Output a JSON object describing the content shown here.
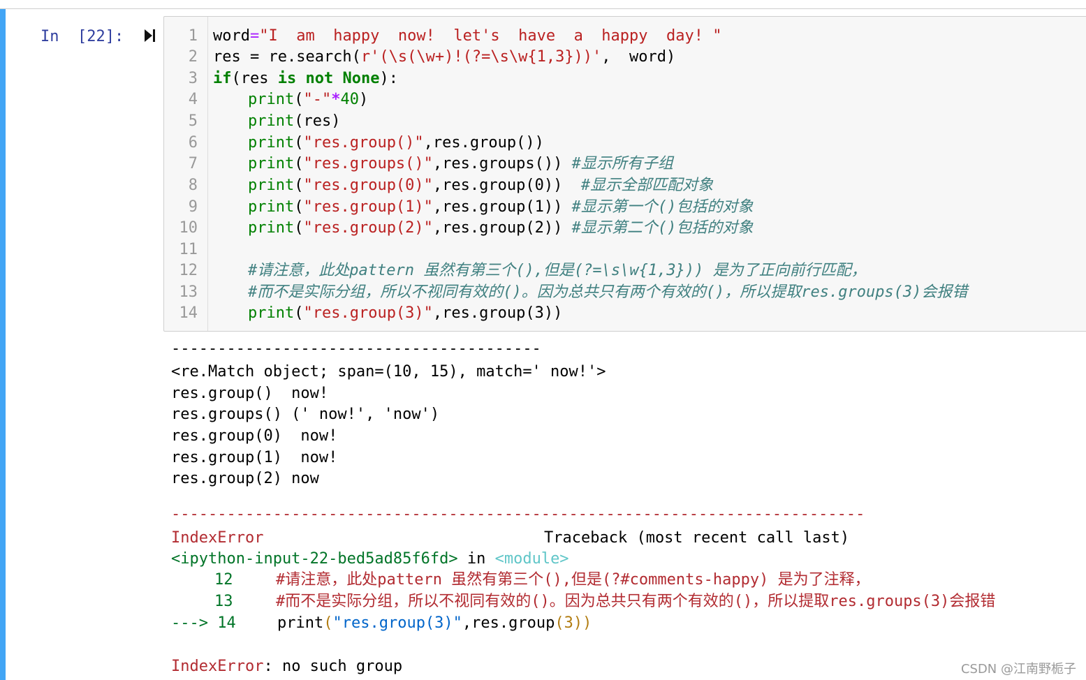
{
  "cell": {
    "prompt": "In  [22]:",
    "run_icon": "run-cell-icon",
    "line_numbers": [
      "1",
      "2",
      "3",
      "4",
      "5",
      "6",
      "7",
      "8",
      "9",
      "10",
      "11",
      "12",
      "13",
      "14"
    ]
  },
  "code": {
    "l1_word": "word",
    "l1_eq": "=",
    "l1_str": "\"I  am  happy  now!  let's  have  a  happy  day! \"",
    "l2_a": "res = re.search(",
    "l2_str": "r'(\\s(\\w+)!(?=\\s\\w{1,3}))'",
    "l2_b": ",  word)",
    "l3_if": "if",
    "l3_a": "(res ",
    "l3_is": "is",
    "l3_sp": " ",
    "l3_not": "not",
    "l3_sp2": " ",
    "l3_none": "None",
    "l3_b": "):",
    "print": "print",
    "l4_open": "(",
    "l4_str": "\"-\"",
    "l4_op": "*",
    "l4_num": "40",
    "l4_close": ")",
    "l5_rest": "(res)",
    "l6_str": "\"res.group()\"",
    "l6_rest": ",res.group())",
    "l7_str": "\"res.groups()\"",
    "l7_rest": ",res.groups()) ",
    "l7_cm": "#显示所有子组",
    "l8_str": "\"res.group(0)\"",
    "l8_rest": ",res.group(0))  ",
    "l8_cm": "#显示全部匹配对象",
    "l9_str": "\"res.group(1)\"",
    "l9_rest": ",res.group(1)) ",
    "l9_cm": "#显示第一个()包括的对象",
    "l10_str": "\"res.group(2)\"",
    "l10_rest": ",res.group(2)) ",
    "l10_cm": "#显示第二个()包括的对象",
    "l12_cm": "#请注意，此处pattern 虽然有第三个(),但是(?=\\s\\w{1,3})) 是为了正向前行匹配，",
    "l13_cm": "#而不是实际分组，所以不视同有效的()。因为总共只有两个有效的()，所以提取res.groups(3)会报错",
    "l14_str": "\"res.group(3)\"",
    "l14_rest": ",res.group(3))"
  },
  "output": {
    "dashes": "----------------------------------------",
    "match_obj": "<re.Match object; span=(10, 15), match=' now!'>",
    "o_group": "res.group()  now!",
    "o_groups": "res.groups() (' now!', 'now')",
    "o_group0": "res.group(0)  now!",
    "o_group1": "res.group(1)  now!",
    "o_group2": "res.group(2) now"
  },
  "traceback": {
    "sep": "---------------------------------------------------------------------------",
    "err_name": "IndexError",
    "header_right": "Traceback (most recent call last)",
    "input_ref": "<ipython-input-22-bed5ad85f6fd>",
    "in_text": " in ",
    "module": "<module>",
    "ln12": "12",
    "t12": "#请注意，此处pattern 虽然有第三个(),但是(?#comments-happy) 是为了注释，",
    "ln13": "13",
    "t13": "#而不是实际分组，所以不视同有效的()。因为总共只有两个有效的()，所以提取res.groups(3)会报错",
    "arrow": "---> 14",
    "t14_print": "print",
    "t14_open": "(",
    "t14_str": "\"res.group(3)\"",
    "t14_mid": ",res.group",
    "t14_paren": "(3))",
    "final_name": "IndexError",
    "final_msg": ": no such group"
  },
  "watermark": "CSDN @江南野栀子",
  "colors": {
    "accent_bar": "#42a5f5",
    "prompt": "#303f9f",
    "keyword": "#008000",
    "string": "#ba2121",
    "comment": "#408080",
    "error_red": "#b22b31"
  }
}
